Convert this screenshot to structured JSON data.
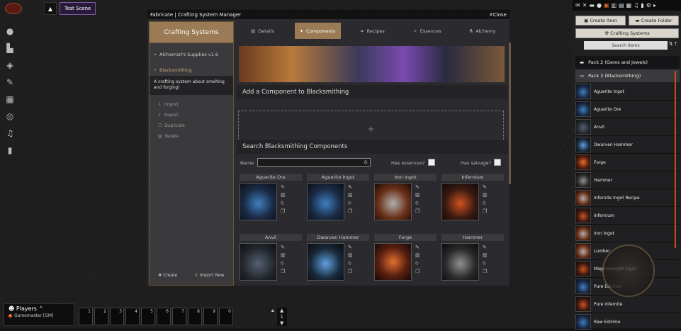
{
  "scene": {
    "label": "Test Scene"
  },
  "window": {
    "title": "Fabricate | Crafting System Manager",
    "close": "Close"
  },
  "sidebar": {
    "title": "Crafting Systems",
    "systems": [
      {
        "label": "Alchemist's Supplies v1.6"
      },
      {
        "label": "Blacksmithing"
      }
    ],
    "description": "A crafting system about smelting and forging!",
    "actions": [
      {
        "label": "Import"
      },
      {
        "label": "Export"
      },
      {
        "label": "Duplicate"
      },
      {
        "label": "Delete"
      }
    ],
    "footer": {
      "create": "Create",
      "import_new": "Import New"
    }
  },
  "tabs": [
    {
      "label": "Details"
    },
    {
      "label": "Components"
    },
    {
      "label": "Recipes"
    },
    {
      "label": "Essences"
    },
    {
      "label": "Alchemy"
    }
  ],
  "content": {
    "add_heading": "Add a Component to Blacksmithing",
    "drop_plus": "+",
    "search_heading": "Search Blacksmithing Components",
    "name_label": "Name",
    "essences_label": "Has essences?",
    "salvage_label": "Has salvage?"
  },
  "components": [
    {
      "name": "Aguerite Ore"
    },
    {
      "name": "Aguerite Ingot"
    },
    {
      "name": "Iron Ingot"
    },
    {
      "name": "Infernium"
    },
    {
      "name": "Anvil"
    },
    {
      "name": "Dwarven Hammer"
    },
    {
      "name": "Forge"
    },
    {
      "name": "Hammer"
    }
  ],
  "right_panel": {
    "create_item": "Create Item",
    "create_folder": "Create Folder",
    "crafting_systems": "Crafting Systems",
    "search_placeholder": "Search Items",
    "pack2": "Pack 2 (Gems and Jewels)",
    "pack3": "Pack 3 (Blacksmithing)",
    "items": [
      {
        "label": "Aguerite Ingot"
      },
      {
        "label": "Aguerite Ore"
      },
      {
        "label": "Anvil"
      },
      {
        "label": "Dwarven Hammer"
      },
      {
        "label": "Forge"
      },
      {
        "label": "Hammer"
      },
      {
        "label": "Infernite Ingot Recipe"
      },
      {
        "label": "Infernium"
      },
      {
        "label": "Iron Ingot"
      },
      {
        "label": "Lumber"
      },
      {
        "label": "Magmaweight Ingot"
      },
      {
        "label": "Pure Edirime"
      },
      {
        "label": "Pure Infernite"
      },
      {
        "label": "Raw Edirime"
      }
    ]
  },
  "players": {
    "title": "Players",
    "user": "Gamemaster [GM]"
  },
  "hotbar": {
    "slots": [
      "1",
      "2",
      "3",
      "4",
      "5",
      "6",
      "7",
      "8",
      "9",
      "0"
    ],
    "page": "1"
  }
}
